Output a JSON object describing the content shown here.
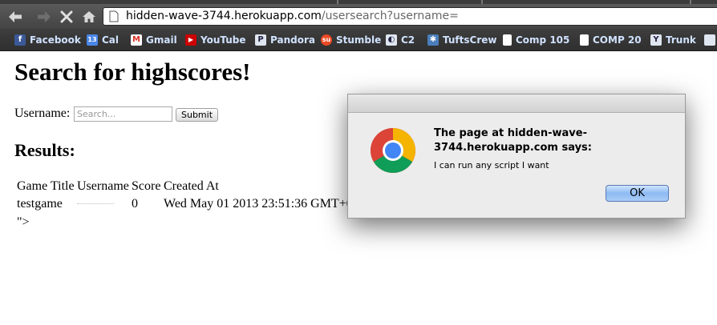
{
  "browser": {
    "url_host": "hidden-wave-3744.herokuapp.com",
    "url_rest": "/usersearch?username=",
    "nav_icons": [
      "back-arrow-icon",
      "forward-arrow-icon",
      "stop-icon",
      "home-icon"
    ],
    "bookmarks": [
      {
        "label": "Facebook",
        "icon": "facebook-icon",
        "icon_glyph": "f",
        "color": "#3b5998"
      },
      {
        "label": "Cal",
        "icon": "calendar-icon",
        "icon_glyph": "13",
        "color": "#4a86e8"
      },
      {
        "label": "Gmail",
        "icon": "gmail-icon",
        "icon_glyph": "M",
        "color": "#d93025"
      },
      {
        "label": "YouTube",
        "icon": "youtube-icon",
        "icon_glyph": "▶",
        "color": "#cc0000"
      },
      {
        "label": "Pandora",
        "icon": "pandora-icon",
        "icon_glyph": "P",
        "color": "#dfe6f0"
      },
      {
        "label": "Stumble",
        "icon": "stumbleupon-icon",
        "icon_glyph": "su",
        "color": "#eb4924"
      },
      {
        "label": "C2",
        "icon": "c2-icon",
        "icon_glyph": "◐",
        "color": "#dfe6f0"
      },
      {
        "label": "TuftsCrew",
        "icon": "tuftscrew-icon",
        "icon_glyph": "✱",
        "color": "#4a7ebb"
      },
      {
        "label": "Comp 105",
        "icon": "page-icon",
        "icon_glyph": "▯",
        "color": "#ffffff"
      },
      {
        "label": "COMP 20",
        "icon": "page-icon",
        "icon_glyph": "▯",
        "color": "#ffffff"
      },
      {
        "label": "Trunk",
        "icon": "trunk-icon",
        "icon_glyph": "Y",
        "color": "#dfe6f0"
      }
    ]
  },
  "page": {
    "title": "Search for highscores!",
    "form": {
      "label": "Username:",
      "placeholder": "Search...",
      "submit_label": "Submit"
    },
    "results_heading": "Results:",
    "table": {
      "headers": [
        "Game Title",
        "Username",
        "Score",
        "Created At"
      ],
      "rows": [
        {
          "game_title": "testgame",
          "username": "",
          "score": "0",
          "created_at": "Wed May 01 2013 23:51:36 GMT+0"
        }
      ]
    },
    "trailing_text": "\">"
  },
  "dialog": {
    "heading": "The page at hidden-wave-3744.herokuapp.com says:",
    "message": "I can run any script I want",
    "ok_label": "OK",
    "icon": "chrome-logo-icon"
  }
}
